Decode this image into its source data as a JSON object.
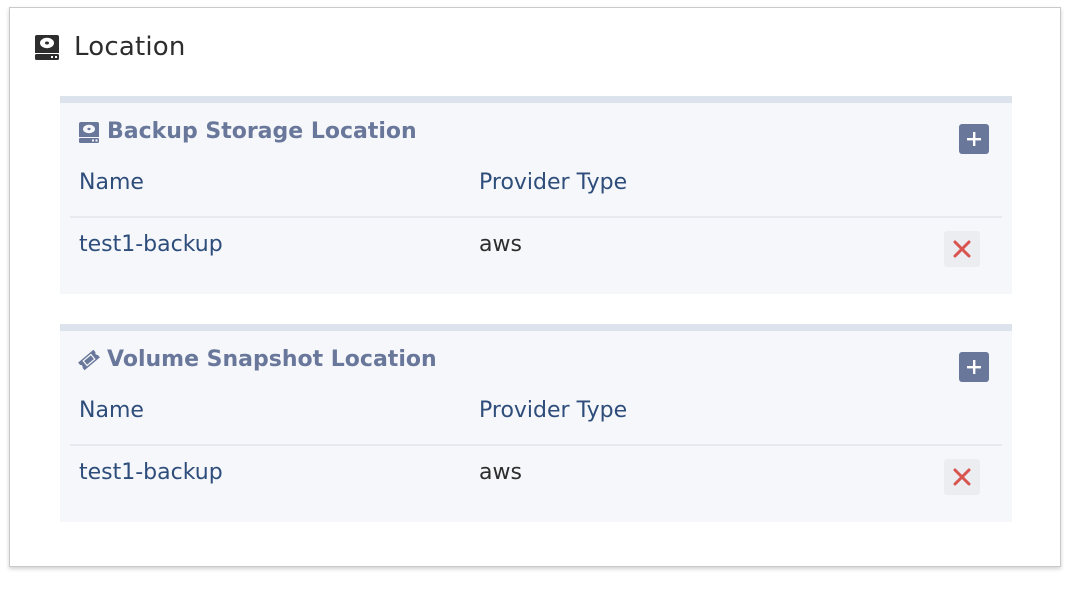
{
  "panel": {
    "title": "Location",
    "icon": "hdd-icon"
  },
  "backup_storage": {
    "title": "Backup Storage Location",
    "icon": "hdd-icon",
    "add_icon": "plus-square-icon",
    "columns": [
      "Name",
      "Provider Type"
    ],
    "rows": [
      {
        "name": "test1-backup",
        "provider_type": "aws",
        "delete_icon": "times-icon"
      }
    ]
  },
  "volume_snapshot": {
    "title": "Volume Snapshot Location",
    "icon": "ticket-icon",
    "add_icon": "plus-square-icon",
    "columns": [
      "Name",
      "Provider Type"
    ],
    "rows": [
      {
        "name": "test1-backup",
        "provider_type": "aws",
        "delete_icon": "times-icon"
      }
    ]
  },
  "colors": {
    "section_title": "#69779b",
    "link": "#2e4d7b",
    "delete": "#d9534f",
    "section_bg": "#f5f7fa",
    "section_border": "#dde3ec"
  }
}
